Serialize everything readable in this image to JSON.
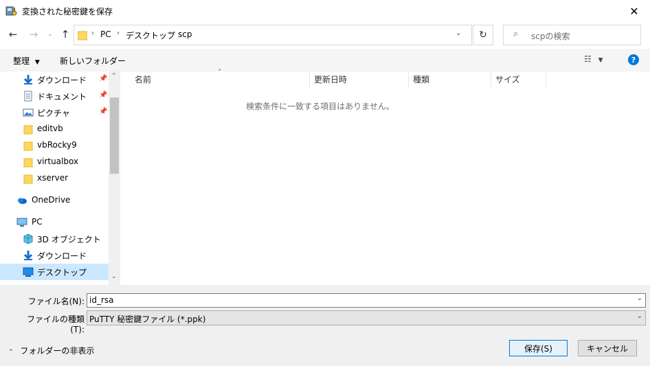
{
  "window": {
    "title": "変換された秘密鍵を保存"
  },
  "nav": {
    "breadcrumb": [
      "PC",
      "デスクトップ",
      "scp"
    ],
    "search_placeholder": "scpの検索"
  },
  "toolbar": {
    "organize": "整理",
    "new_folder": "新しいフォルダー"
  },
  "sidebar": {
    "items": [
      {
        "label": "ダウンロード",
        "icon": "download-icon",
        "pinned": true
      },
      {
        "label": "ドキュメント",
        "icon": "document-icon",
        "pinned": true
      },
      {
        "label": "ピクチャ",
        "icon": "pictures-icon",
        "pinned": true
      },
      {
        "label": "editvb",
        "icon": "folder-icon"
      },
      {
        "label": "vbRocky9",
        "icon": "folder-icon"
      },
      {
        "label": "virtualbox",
        "icon": "folder-icon"
      },
      {
        "label": "xserver",
        "icon": "folder-icon"
      },
      {
        "label": "OneDrive",
        "icon": "cloud-icon"
      },
      {
        "label": "PC",
        "icon": "pc-icon"
      },
      {
        "label": "3D オブジェクト",
        "icon": "3d-objects-icon"
      },
      {
        "label": "ダウンロード",
        "icon": "download-icon"
      },
      {
        "label": "デスクトップ",
        "icon": "desktop-icon",
        "selected": true
      }
    ]
  },
  "filelist": {
    "columns": [
      "名前",
      "更新日時",
      "種類",
      "サイズ"
    ],
    "empty_message": "検索条件に一致する項目はありません。"
  },
  "form": {
    "filename_label": "ファイル名(N):",
    "filename_value": "id_rsa",
    "filetype_label": "ファイルの種類(T):",
    "filetype_value": "PuTTY 秘密鍵ファイル (*.ppk)",
    "hide_folders": "フォルダーの非表示",
    "save": "保存(S)",
    "cancel": "キャンセル"
  },
  "colors": {
    "accent": "#0078d7",
    "selected_bg": "#cce8ff",
    "folder": "#ffd75e"
  }
}
